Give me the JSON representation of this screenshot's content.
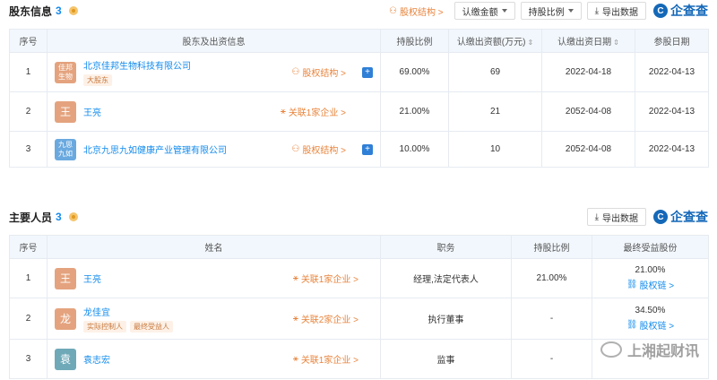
{
  "shareholders": {
    "title": "股东信息",
    "count": "3",
    "equity_structure_label": "股权结构 >",
    "dropdown_amount": "认缴金额",
    "dropdown_ratio": "持股比例",
    "export_label": "导出数据",
    "logo_text": "企查查",
    "logo_mark": "C",
    "columns": [
      "序号",
      "股东及出资信息",
      "持股比例",
      "认缴出资额(万元)",
      "认缴出资日期",
      "参股日期"
    ],
    "rows": [
      {
        "index": "1",
        "avatar": "佳邦\n生物",
        "name": "北京佳邦生物科技有限公司",
        "tag": "大股东",
        "link": "股权结构 >",
        "ratio": "69.00%",
        "amount": "69",
        "sub_date": "2022-04-18",
        "join_date": "2022-04-13"
      },
      {
        "index": "2",
        "avatar": "王",
        "name": "王亮",
        "tag": "",
        "link": "关联1家企业 >",
        "ratio": "21.00%",
        "amount": "21",
        "sub_date": "2052-04-08",
        "join_date": "2022-04-13"
      },
      {
        "index": "3",
        "avatar": "九思\n九如",
        "name": "北京九思九如健康产业管理有限公司",
        "tag": "",
        "link": "股权结构 >",
        "ratio": "10.00%",
        "amount": "10",
        "sub_date": "2052-04-08",
        "join_date": "2022-04-13"
      }
    ]
  },
  "key_personnel": {
    "title": "主要人员",
    "count": "3",
    "export_label": "导出数据",
    "logo_text": "企查查",
    "logo_mark": "C",
    "columns": [
      "序号",
      "姓名",
      "职务",
      "持股比例",
      "最终受益股份"
    ],
    "rows": [
      {
        "index": "1",
        "avatar": "王",
        "name": "王亮",
        "tag1": "",
        "tag2": "",
        "link": "关联1家企业 >",
        "position": "经理,法定代表人",
        "ratio": "21.00%",
        "benefit": "21.00%",
        "benefit_link": "股权链 >"
      },
      {
        "index": "2",
        "avatar": "龙",
        "name": "龙佳宜",
        "tag1": "实际控制人",
        "tag2": "最终受益人",
        "link": "关联2家企业 >",
        "position": "执行董事",
        "ratio": "-",
        "benefit": "34.50%",
        "benefit_link": "股权链 >"
      },
      {
        "index": "3",
        "avatar": "袁",
        "name": "袁志宏",
        "tag1": "",
        "tag2": "",
        "link": "关联1家企业 >",
        "position": "监事",
        "ratio": "-",
        "benefit": "-",
        "benefit_link": ""
      }
    ]
  },
  "watermark_text": "上湘起财讯",
  "colors": {
    "link_blue": "#128bed",
    "link_orange": "#e8843c",
    "header_bg": "#f2f7fd",
    "logo_blue": "#1468b8"
  }
}
